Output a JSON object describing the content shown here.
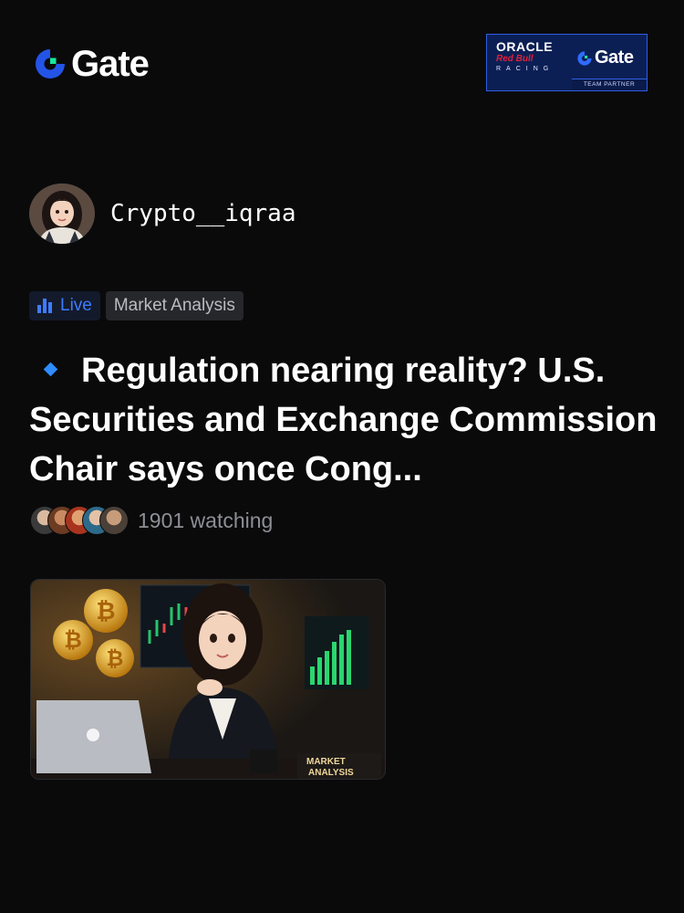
{
  "brand": {
    "logo_text": "Gate"
  },
  "partner_badge": {
    "oracle": "ORACLE",
    "redbull": "Red Bull",
    "racing": "RACING",
    "gate": "Gate",
    "team_partner": "TEAM PARTNER"
  },
  "post": {
    "author": "Crypto__iqraa",
    "tags": {
      "live": "Live",
      "category": "Market Analysis"
    },
    "title": "Regulation nearing reality? U.S. Securities and Exchange Commission Chair says once Cong...",
    "watching": "1901 watching",
    "thumbnail_caption": [
      "MARKET",
      "ANALYSIS"
    ]
  },
  "colors": {
    "background": "#0a0a0b",
    "accent": "#3d7cff",
    "diamond": "#2f8cff"
  }
}
